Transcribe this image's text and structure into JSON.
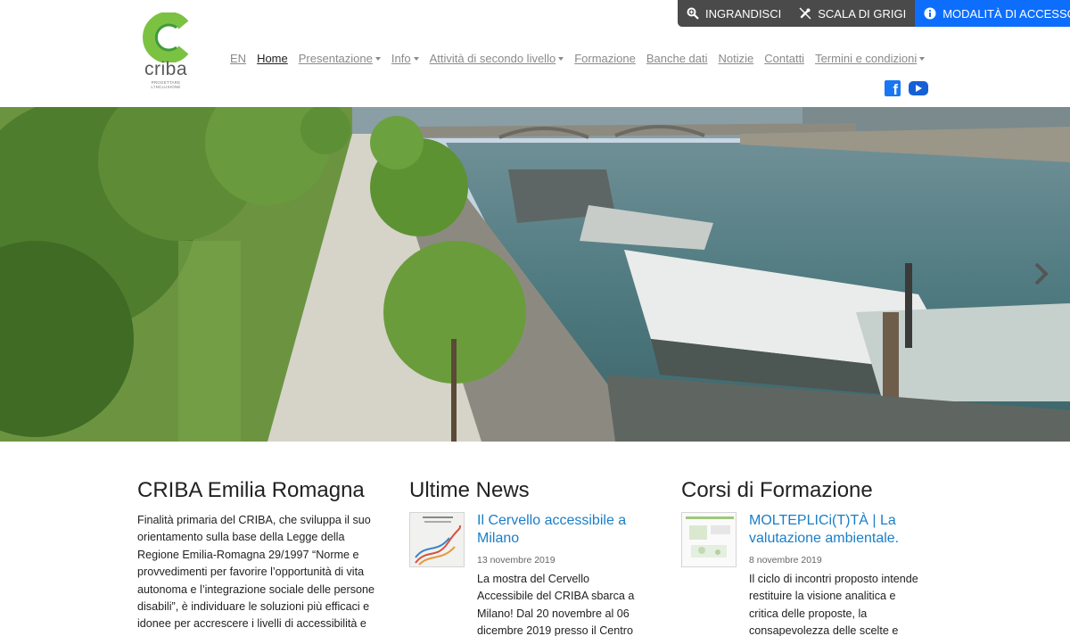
{
  "accessibility": {
    "zoom_label": "INGRANDISCI",
    "grayscale_label": "SCALA DI GRIGI",
    "access_mode_label": "MODALITÀ DI ACCESSO"
  },
  "logo": {
    "name": "criba",
    "tagline": "PROGETTARE L'INCLUSIONE"
  },
  "nav": {
    "items": [
      {
        "label": "EN"
      },
      {
        "label": "Home"
      },
      {
        "label": "Presentazione"
      },
      {
        "label": "Info"
      },
      {
        "label": "Attività di secondo livello"
      },
      {
        "label": "Formazione"
      },
      {
        "label": "Banche dati"
      },
      {
        "label": "Notizie"
      },
      {
        "label": "Contatti"
      },
      {
        "label": "Termini e condizioni"
      }
    ]
  },
  "colors": {
    "accent_blue": "#0d6efd",
    "link_blue": "#1a7ec8",
    "logo_green": "#7cc242",
    "toolbar_dark": "#4a4a4a"
  },
  "intro": {
    "title": "CRIBA Emilia Romagna",
    "text": "Finalità primaria del CRIBA, che sviluppa il suo orientamento sulla base della Legge della Regione Emilia-Romagna 29/1997 “Norme e provvedimenti per favorire l’opportunità di vita autonoma e l’integrazione sociale delle persone disabili”, è individuare le soluzioni più efficaci e idonee per accrescere i livelli di accessibilità e fruibilità del territorio, degli spazi..."
  },
  "news": {
    "title": "Ultime News",
    "item": {
      "title": "Il Cervello accessibile a Milano",
      "date": "13 novembre 2019",
      "text": "La mostra del Cervello Accessibile del CRIBA sbarca a Milano! Dal 20 novembre al 06 dicembre 2019 presso il Centro Culturale"
    }
  },
  "courses": {
    "title": "Corsi di Formazione",
    "item": {
      "title": "MOLTEPLICi(T)TÀ | La valutazione ambientale.",
      "date": "8 novembre 2019",
      "text": "Il ciclo di incontri proposto intende restituire la visione analitica e critica delle proposte, la consapevolezza delle scelte e delle loro"
    }
  }
}
